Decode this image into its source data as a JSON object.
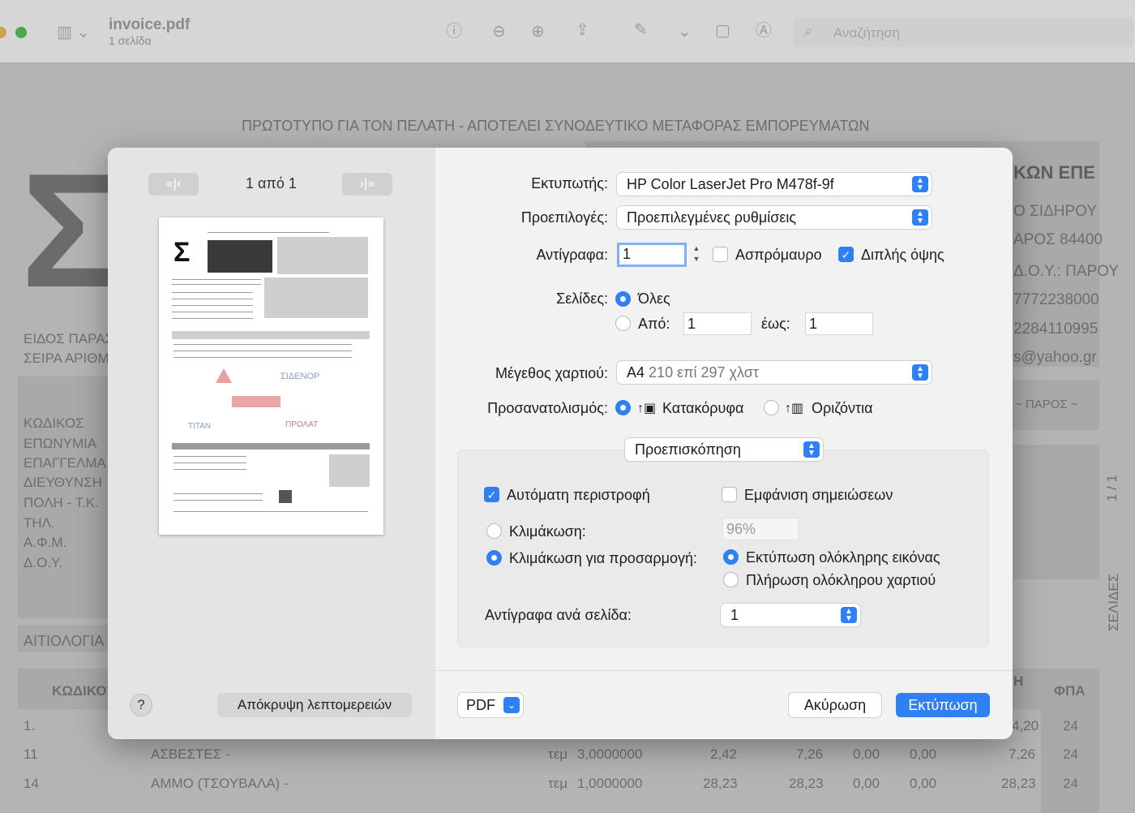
{
  "window": {
    "title": "invoice.pdf",
    "subtitle": "1 σελίδα",
    "search_placeholder": "Αναζήτηση"
  },
  "background_doc": {
    "header": "ΠΡΩΤΟΤΥΠΟ ΓΙΑ ΤΟΝ ΠΕΛΑΤΗ - ΑΠΟΤΕΛΕΙ ΣΥΝΟΔΕΥΤΙΚΟ ΜΕΤΑΦΟΡΑΣ ΕΜΠΟΡΕΥΜΑΤΩΝ",
    "right_lines": [
      "ΚΩΝ ΕΠΕ",
      "Ο ΣΙΔΗΡΟΥ",
      "ΑΡΟΣ 84400",
      "Δ.Ο.Υ.: ΠΑΡΟΥ",
      "7772238000",
      "2284110995",
      "s@yahoo.gr",
      "~ ΠΑΡΟΣ ~"
    ],
    "left_top": [
      "ΕΙΔΟΣ ΠΑΡΑΣ",
      "ΣΕΙΡΑ ΑΡΙΘΜ"
    ],
    "left_fields": [
      "ΚΩΔΙΚΟΣ",
      "ΕΠΩΝΥΜΙΑ",
      "ΕΠΑΓΓΕΛΜΑ",
      "ΔΙΕΥΘΥΝΣΗ",
      "ΠΟΛΗ - Τ.Κ.",
      "ΤΗΛ.",
      "Α.Φ.Μ.",
      "Δ.Ο.Υ."
    ],
    "aitiologia": "ΑΙΤΙΟΛΟΓΙΑ",
    "col_kodikos": "ΚΩΔΙΚΟΣ",
    "col_h": "Η",
    "col_fpa": "ΦΠΑ",
    "side_page": "1 / 1",
    "side_pages": "ΣΕΛΙΔΕΣ",
    "rows": [
      {
        "code": "1.",
        "desc": "",
        "unit": "",
        "qty": "",
        "v1": "",
        "v2": "",
        "v3": "",
        "v4": "",
        "v5": "4,20",
        "vat": "24"
      },
      {
        "code": "11",
        "desc": "ΑΣΒΕΣΤΕΣ -",
        "unit": "τεμ",
        "qty": "3,0000000",
        "v1": "2,42",
        "v2": "7,26",
        "v3": "0,00",
        "v4": "0,00",
        "v5": "7,26",
        "vat": "24"
      },
      {
        "code": "14",
        "desc": "ΑΜΜΟ (ΤΣΟΥΒΑΛΑ) -",
        "unit": "τεμ",
        "qty": "1,0000000",
        "v1": "28,23",
        "v2": "28,23",
        "v3": "0,00",
        "v4": "0,00",
        "v5": "28,23",
        "vat": "24"
      }
    ]
  },
  "dialog": {
    "page_counter": "1 από 1",
    "help": "?",
    "hide_details": "Απόκρυψη λεπτομερειών",
    "printer_label": "Εκτυπωτής:",
    "printer_value": "HP Color LaserJet Pro M478f-9f",
    "presets_label": "Προεπιλογές:",
    "presets_value": "Προεπιλεγμένες ρυθμίσεις",
    "copies_label": "Αντίγραφα:",
    "copies_value": "1",
    "bw_label": "Ασπρόμαυρο",
    "duplex_label": "Διπλής όψης",
    "pages_label": "Σελίδες:",
    "pages_all": "Όλες",
    "pages_from": "Από:",
    "pages_from_value": "1",
    "pages_to": "έως:",
    "pages_to_value": "1",
    "paper_label": "Μέγεθος χαρτιού:",
    "paper_value": "A4",
    "paper_detail": "210 επί 297 χλστ",
    "orientation_label": "Προσανατολισμός:",
    "portrait": "Κατακόρυφα",
    "landscape": "Οριζόντια",
    "section_value": "Προεπισκόπηση",
    "auto_rotate": "Αυτόματη περιστροφή",
    "show_notes": "Εμφάνιση σημειώσεων",
    "scale_label": "Κλιμάκωση:",
    "scale_value": "96%",
    "scale_fit_label": "Κλιμάκωση για προσαρμογή:",
    "print_entire": "Εκτύπωση ολόκληρης εικόνας",
    "fill_paper": "Πλήρωση ολόκληρου χαρτιού",
    "copies_per_page_label": "Αντίγραφα ανά σελίδα:",
    "copies_per_page_value": "1",
    "pdf": "PDF",
    "cancel": "Ακύρωση",
    "print": "Εκτύπωση"
  },
  "colors": {
    "accent": "#2f7ff5"
  }
}
